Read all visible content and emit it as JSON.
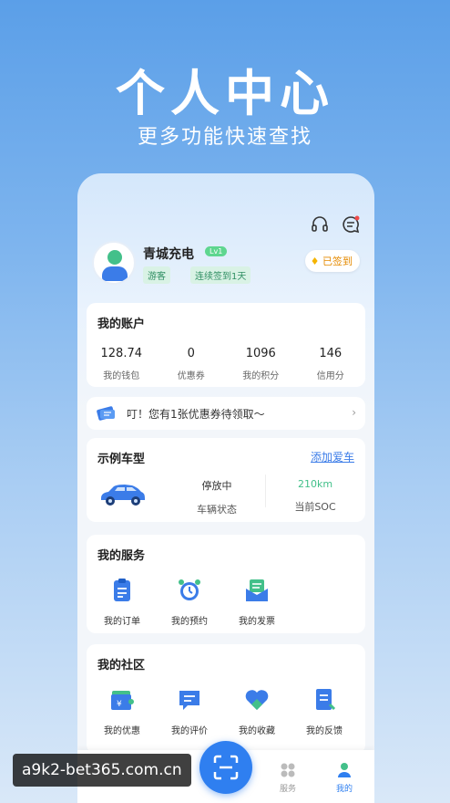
{
  "hero": {
    "title": "个人中心",
    "subtitle": "更多功能快速查找"
  },
  "profile": {
    "name": "青城充电",
    "level": "Lv1",
    "tags": [
      "游客",
      "连续签到1天"
    ],
    "signed_label": "已签到"
  },
  "account": {
    "title": "我的账户",
    "items": [
      {
        "value": "128.74",
        "label": "我的钱包"
      },
      {
        "value": "0",
        "label": "优惠券"
      },
      {
        "value": "1096",
        "label": "我的积分"
      },
      {
        "value": "146",
        "label": "信用分"
      }
    ]
  },
  "notice": {
    "text": "叮！您有1张优惠券待领取～",
    "arrow": "›"
  },
  "car": {
    "title": "示例车型",
    "add_link": "添加爱车",
    "status_value": "停放中",
    "status_label": "车辆状态",
    "soc_value": "210km",
    "soc_label": "当前SOC"
  },
  "services": {
    "title": "我的服务",
    "items": [
      {
        "label": "我的订单",
        "icon": "order-icon"
      },
      {
        "label": "我的预约",
        "icon": "alarm-clock-icon"
      },
      {
        "label": "我的发票",
        "icon": "invoice-icon"
      }
    ]
  },
  "community": {
    "title": "我的社区",
    "items": [
      {
        "label": "我的优惠",
        "icon": "coupon-icon"
      },
      {
        "label": "我的评价",
        "icon": "comment-icon"
      },
      {
        "label": "我的收藏",
        "icon": "heart-icon"
      },
      {
        "label": "我的反馈",
        "icon": "feedback-icon"
      }
    ]
  },
  "tabbar": {
    "items": [
      {
        "label": "服务",
        "icon": "grid-icon"
      },
      {
        "label": "我的",
        "icon": "user-icon"
      }
    ],
    "scan_icon": "scan-icon"
  },
  "colors": {
    "accent": "#2f7ff0",
    "green": "#43c08a"
  },
  "watermark": "a9k2-bet365.com.cn"
}
